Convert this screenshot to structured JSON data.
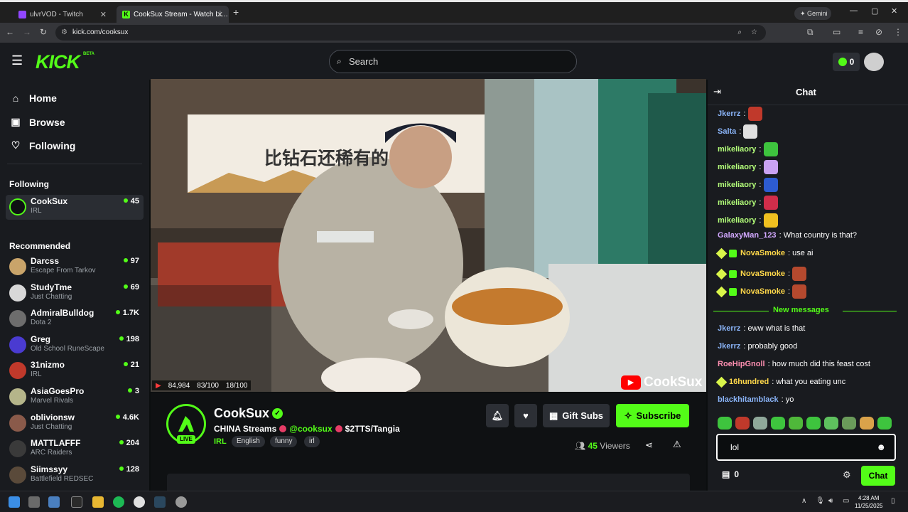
{
  "browser": {
    "tabs": [
      {
        "title": "ulvrVOD - Twitch",
        "active": false
      },
      {
        "title": "CookSux Stream - Watch Li…",
        "active": true
      }
    ],
    "new_tab": "+",
    "gemini_label": "Gemini",
    "url": "kick.com/cooksux"
  },
  "header": {
    "logo": "KICK",
    "logo_beta": "BETA",
    "search_placeholder": "Search",
    "kicks_count": "0"
  },
  "sidebar": {
    "nav": [
      {
        "label": "Home",
        "icon": "home-icon"
      },
      {
        "label": "Browse",
        "icon": "browse-icon"
      },
      {
        "label": "Following",
        "icon": "heart-icon"
      }
    ],
    "following_title": "Following",
    "following": [
      {
        "name": "CookSux",
        "category": "IRL",
        "viewers": "45"
      }
    ],
    "recommended_title": "Recommended",
    "recommended": [
      {
        "name": "Darcss",
        "category": "Escape From Tarkov",
        "viewers": "97",
        "color": "#c9a46a"
      },
      {
        "name": "StudyTme",
        "category": "Just Chatting",
        "viewers": "69",
        "color": "#d8d8d8"
      },
      {
        "name": "AdmiralBulldog",
        "category": "Dota 2",
        "viewers": "1.7K",
        "color": "#6d6d6d"
      },
      {
        "name": "Greg",
        "category": "Old School RuneScape",
        "viewers": "198",
        "color": "#4a3bd1"
      },
      {
        "name": "31nizmo",
        "category": "IRL",
        "viewers": "21",
        "color": "#c0392b"
      },
      {
        "name": "AsiaGoesPro",
        "category": "Marvel Rivals",
        "viewers": "3",
        "color": "#b5b58a"
      },
      {
        "name": "oblivionsw",
        "category": "Just Chatting",
        "viewers": "4.6K",
        "color": "#8a5a4a"
      },
      {
        "name": "MATTLAFFF",
        "category": "ARC Raiders",
        "viewers": "204",
        "color": "#3a3a3a"
      },
      {
        "name": "Siimssyy",
        "category": "Battlefield REDSEC",
        "viewers": "128",
        "color": "#5a4a3a"
      }
    ]
  },
  "video": {
    "sign_text": "比钻石还稀有的",
    "watermark": "CookSux",
    "overlay_stats": [
      "84,984",
      "83/100",
      "18/100"
    ]
  },
  "stream": {
    "channel": "CookSux",
    "live_badge": "LIVE",
    "title_prefix": "CHINA Streams",
    "handle": "@cooksux",
    "tts": "$2TTS/Tangia",
    "category": "IRL",
    "tags": [
      "English",
      "funny",
      "irl"
    ],
    "gift_subs": "Gift Subs",
    "subscribe": "Subscribe",
    "viewer_count": "45",
    "viewers_label": "Viewers"
  },
  "chat": {
    "title": "Chat",
    "messages": [
      {
        "user": "Jkerrz",
        "color": "#8ab4f8",
        "text": "",
        "emote": "#c0392b"
      },
      {
        "user": "Salta",
        "color": "#8ab4f8",
        "text": "",
        "emote": "#e0e0e0"
      },
      {
        "user": "mikeliaory",
        "color": "#b4ff7a",
        "text": "",
        "emote": "#3ec43e"
      },
      {
        "user": "mikeliaory",
        "color": "#b4ff7a",
        "text": "",
        "emote": "#c9a2f2"
      },
      {
        "user": "mikeliaory",
        "color": "#b4ff7a",
        "text": "",
        "emote": "#2d5bd1"
      },
      {
        "user": "mikeliaory",
        "color": "#b4ff7a",
        "text": "",
        "emote": "#d12d4a"
      },
      {
        "user": "mikeliaory",
        "color": "#b4ff7a",
        "text": "",
        "emote": "#f0c020"
      },
      {
        "user": "GalaxyMan_123",
        "color": "#d2a8ff",
        "text": "What country is that?",
        "emote": ""
      },
      {
        "user": "NovaSmoke",
        "color": "#ffd84a",
        "text": "use ai",
        "emote": ""
      },
      {
        "user": "NovaSmoke",
        "color": "#ffd84a",
        "text": "",
        "emote": "#b5492e"
      },
      {
        "user": "NovaSmoke",
        "color": "#ffd84a",
        "text": "",
        "emote": "#b5492e"
      }
    ],
    "new_messages_label": "New messages",
    "new_messages": [
      {
        "user": "Jkerrz",
        "color": "#8ab4f8",
        "text": "eww what is that"
      },
      {
        "user": "Jkerrz",
        "color": "#8ab4f8",
        "text": "probably good"
      },
      {
        "user": "RoeHipGnoll",
        "color": "#ff8fb1",
        "text": "how much did this feast cost"
      },
      {
        "user": "16hundred",
        "color": "#ffd84a",
        "text": "what you eating unc"
      },
      {
        "user": "blackhitamblack",
        "color": "#8ab4f8",
        "text": "yo"
      }
    ],
    "input_value": "lol",
    "points": "0",
    "send_label": "Chat"
  },
  "taskbar": {
    "time": "4:28 AM",
    "date": "11/25/2025"
  }
}
